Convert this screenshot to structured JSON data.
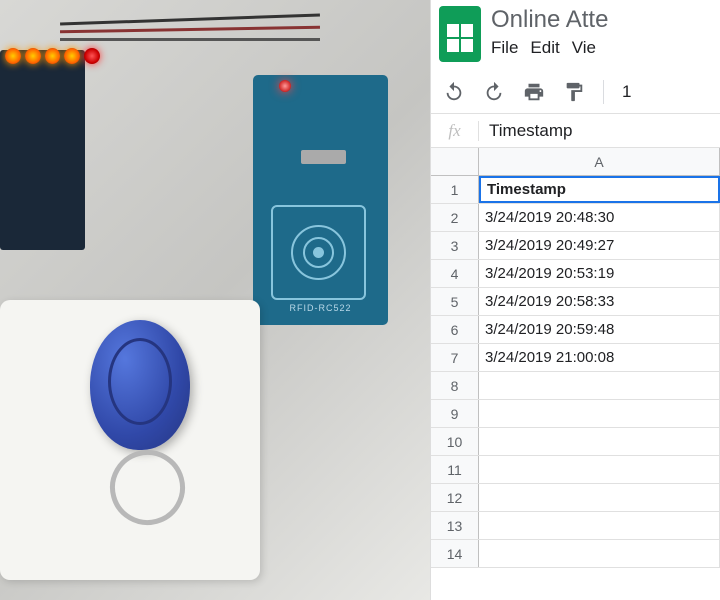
{
  "app": {
    "doc_title": "Online Atte",
    "menu": {
      "file": "File",
      "edit": "Edit",
      "view": "Vie"
    },
    "toolbar": {
      "zoom": "1"
    },
    "formula_bar": {
      "fx": "fx",
      "value": "Timestamp"
    },
    "col_headers": {
      "A": "A"
    },
    "rows": [
      {
        "num": "1",
        "val": "Timestamp",
        "bold": true,
        "selected": true
      },
      {
        "num": "2",
        "val": "3/24/2019 20:48:30"
      },
      {
        "num": "3",
        "val": "3/24/2019 20:49:27"
      },
      {
        "num": "4",
        "val": "3/24/2019 20:53:19"
      },
      {
        "num": "5",
        "val": "3/24/2019 20:58:33"
      },
      {
        "num": "6",
        "val": "3/24/2019 20:59:48"
      },
      {
        "num": "7",
        "val": "3/24/2019 21:00:08"
      },
      {
        "num": "8",
        "val": ""
      },
      {
        "num": "9",
        "val": ""
      },
      {
        "num": "10",
        "val": ""
      },
      {
        "num": "11",
        "val": ""
      },
      {
        "num": "12",
        "val": ""
      },
      {
        "num": "13",
        "val": ""
      },
      {
        "num": "14",
        "val": ""
      }
    ]
  },
  "hardware": {
    "rfid_label": "RFID-RC522"
  }
}
